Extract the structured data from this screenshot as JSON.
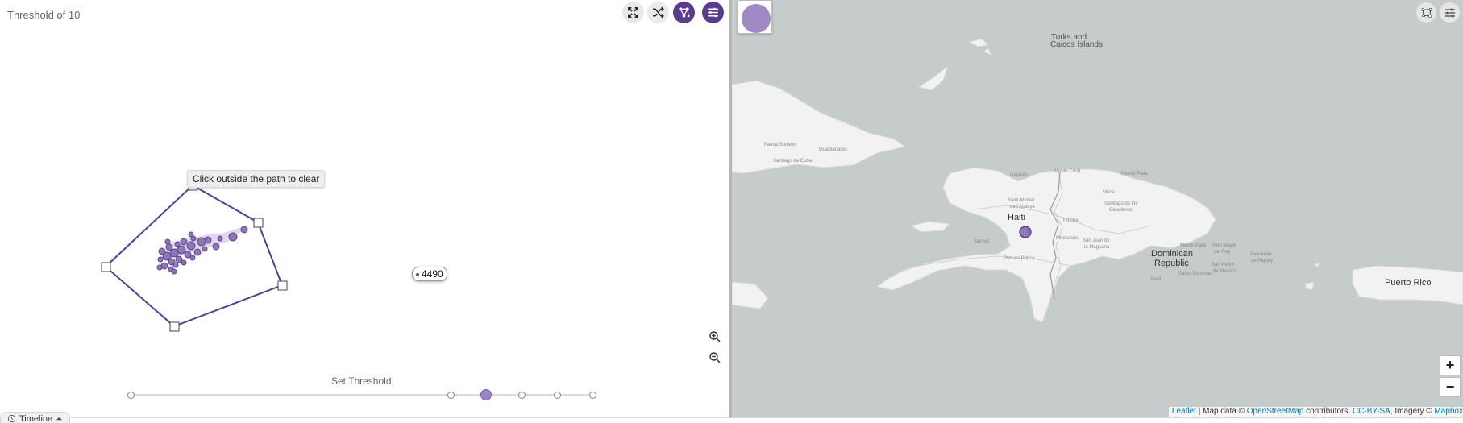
{
  "left": {
    "title": "Threshold of 10",
    "toolbar": {
      "fullscreen_icon": "expand-icon",
      "shuffle_icon": "shuffle-icon",
      "network_icon": "network-icon",
      "settings_icon": "sliders-icon"
    },
    "tooltip": "Click outside the path to clear",
    "node_label": "4490",
    "zoom_in_icon": "zoom-in-icon",
    "zoom_out_icon": "zoom-out-icon",
    "slider": {
      "label": "Set Threshold",
      "tick_count": 6,
      "selected_index": 2
    },
    "timeline_label": "Timeline"
  },
  "map": {
    "labels": {
      "turks": "Turks and",
      "caicos": "Caicos Islands",
      "haiti": "Haiti",
      "dominican": "Dominican",
      "republic": "Republic",
      "puerto_rico": "Puerto Rico",
      "santiago_cuba": "Santiago de Cuba",
      "palma_soriano": "Palma Soriano",
      "guantanamo": "Guantánamo",
      "saint_michel": "Saint-Michel",
      "de_attalaye": "de l'Atalaye",
      "hinche": "Hinche",
      "santiago": "Santiago de los",
      "caballeros": "Caballeros",
      "mirebalais": "Mirebalais",
      "san_juan": "San Juan de",
      "la_maguana": "la Maguana",
      "jacmel_area": "Jacmel",
      "port_au_prince": "Port-au-Prince",
      "santo_domingo": "Santo Domingo",
      "hato_mayor": "Hato Mayor",
      "del_rey": "del Rey",
      "monte_plata": "Monte Plata",
      "san_pedro": "San Pedro",
      "de_macoris": "de Macorís",
      "salvaleon": "Salvaleón",
      "de_higuey": "de Higüey",
      "bani": "Baní",
      "moca": "Moca",
      "puerto_plata": "Puerto Plata",
      "dajabon": "Dajabón",
      "monte_cristi": "Monte Cristi"
    },
    "zoom_in": "+",
    "zoom_out": "−",
    "attribution": {
      "leaflet": "Leaflet",
      "sep1": " | Map data © ",
      "osm": "OpenStreetMap",
      "contrib": " contributors, ",
      "ccbysa": "CC-BY-SA",
      "imagery": ", Imagery © ",
      "mapbox": "Mapbox"
    },
    "toolbar": {
      "lasso_icon": "lasso-icon",
      "settings_icon": "sliders-icon"
    }
  },
  "colors": {
    "accent": "#5b3b8c",
    "node": "#8e77b8",
    "map_water": "#c6cbcc",
    "map_land": "#f2f2f2"
  }
}
